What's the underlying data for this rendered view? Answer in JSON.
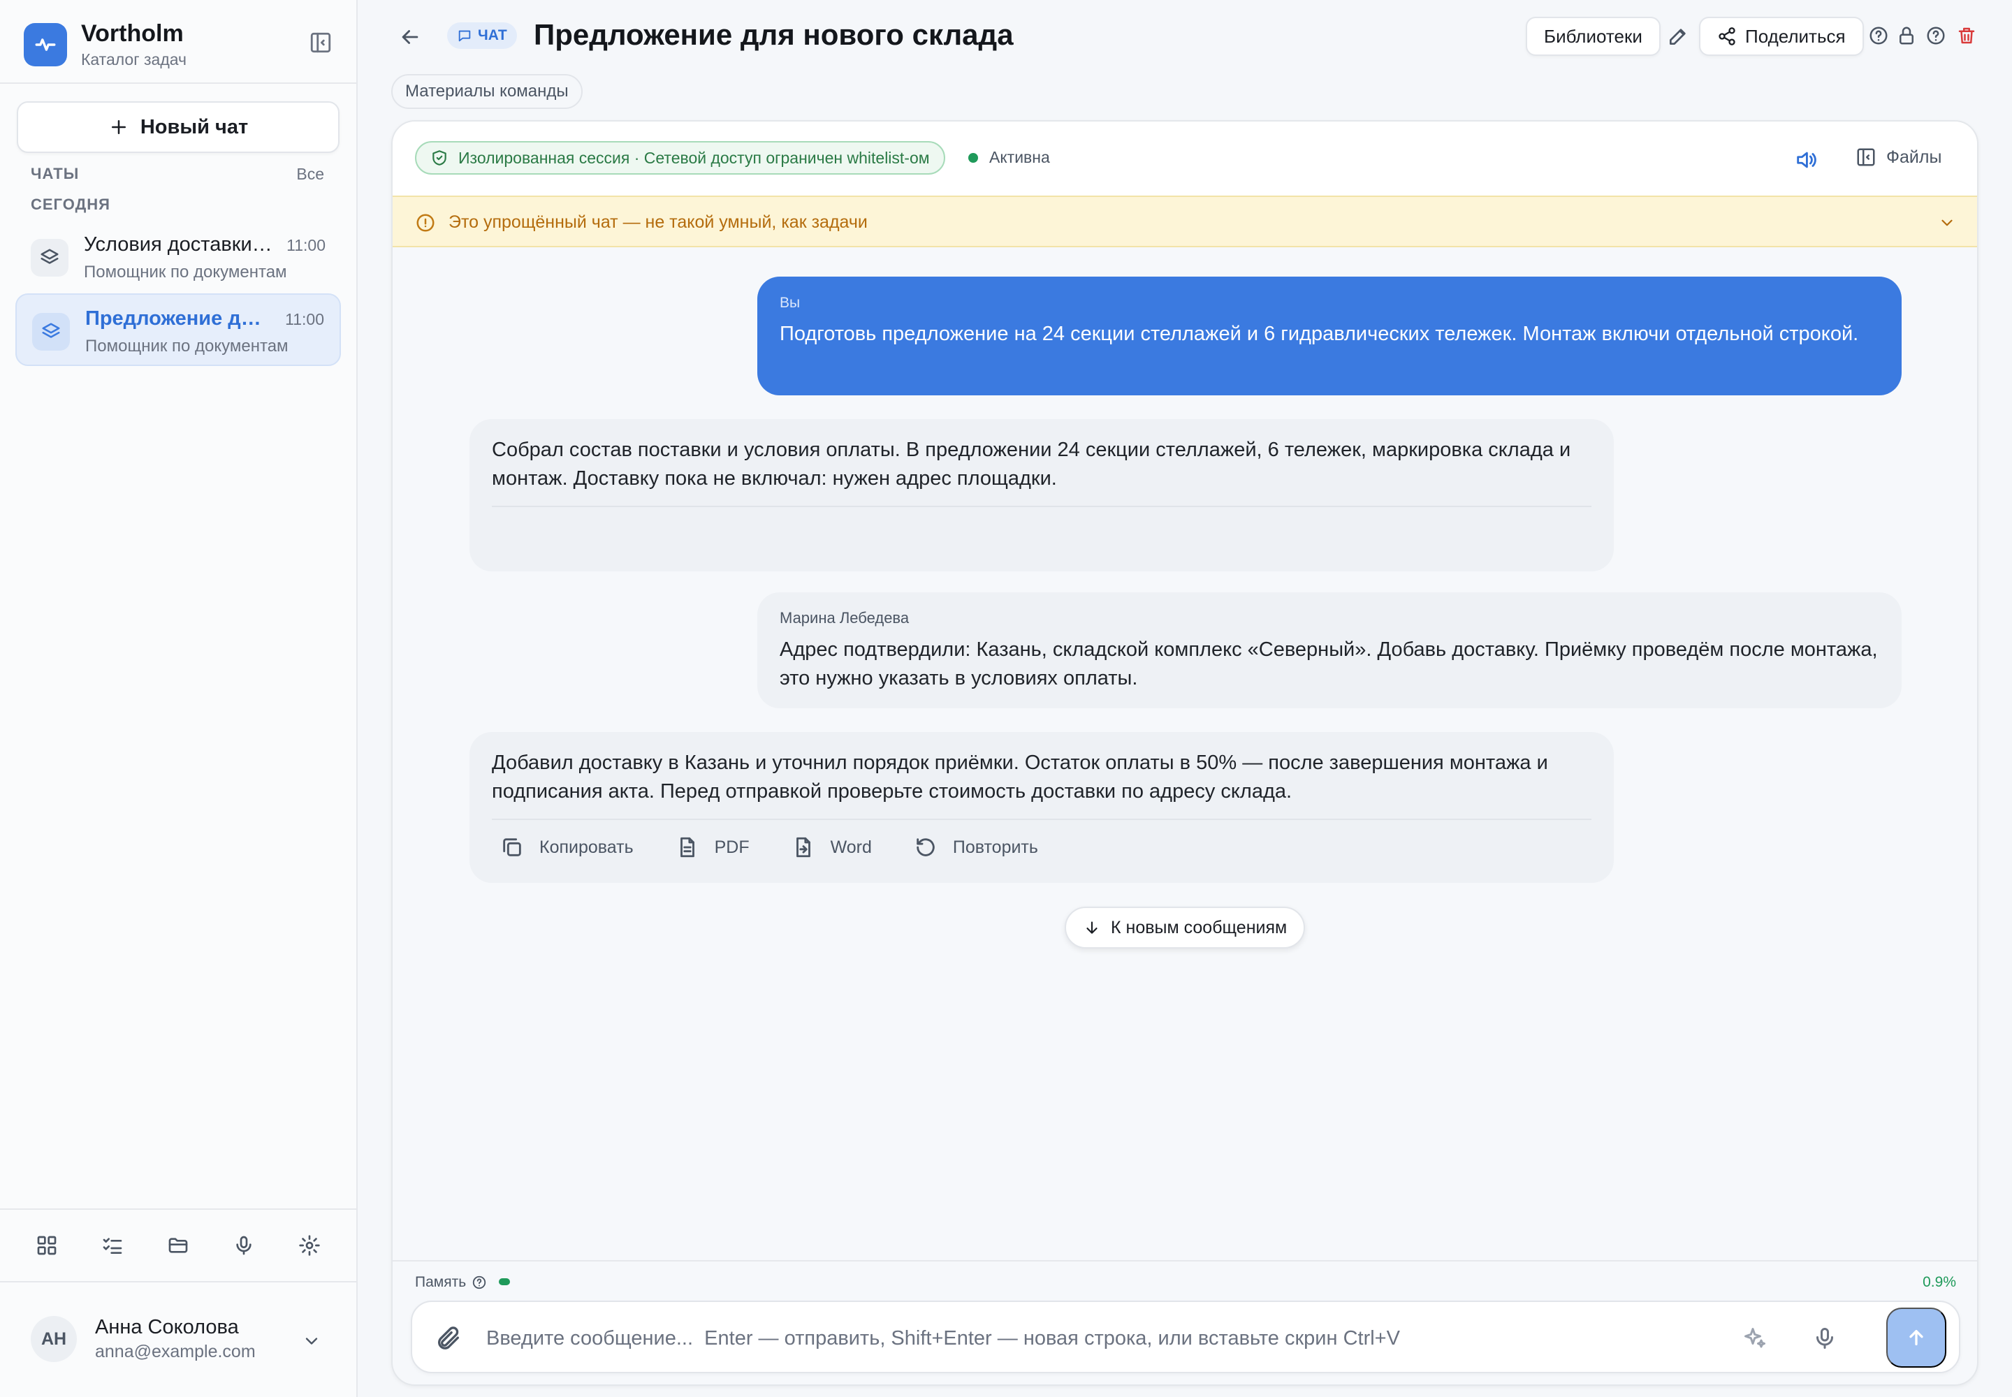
{
  "brand": {
    "title": "Vortholm",
    "subtitle": "Каталог задач"
  },
  "sidebar": {
    "new_chat_label": "Новый чат",
    "chats_label": "ЧАТЫ",
    "all_label": "Все",
    "today_label": "СЕГОДНЯ",
    "chats": [
      {
        "title": "Условия доставки по договору",
        "time": "11:00",
        "subtitle": "Помощник по документам",
        "active": false
      },
      {
        "title": "Предложение для нового склада",
        "time": "11:00",
        "subtitle": "Помощник по документам",
        "active": true
      }
    ],
    "tools": [
      "grid-icon",
      "checklist-icon",
      "folder-icon",
      "mic-icon",
      "gear-icon"
    ]
  },
  "user": {
    "initials": "АН",
    "name": "Анна Соколова",
    "email": "anna@example.com"
  },
  "header": {
    "badge": "ЧАТ",
    "title": "Предложение для нового склада",
    "libraries_label": "Библиотеки",
    "share_label": "Поделиться",
    "team_chip": "Материалы команды"
  },
  "panel": {
    "isolation_text": "Изолированная сессия · Сетевой доступ ограничен whitelist-ом",
    "status_text": "Активна",
    "files_label": "Файлы",
    "warning_text": "Это упрощённый чат — не такой умный, как задачи"
  },
  "messages": {
    "user1": {
      "author": "Вы",
      "text": "Подготовь предложение на 24 секции стеллажей и 6 гидравлических тележек. Монтаж включи отдельной строкой."
    },
    "bot1": {
      "text": "Собрал состав поставки и условия оплаты. В предложении 24 секции стеллажей, 6 тележек, маркировка склада и монтаж. Доставку пока не включал: нужен адрес площадки."
    },
    "user2": {
      "author": "Марина Лебедева",
      "text": "Адрес подтвердили: Казань, складской комплекс «Северный». Добавь доставку. Приёмку проведём после монтажа, это нужно указать в условиях оплаты."
    },
    "bot2": {
      "text": "Добавил доставку в Казань и уточнил порядок приёмки. Остаток оплаты в 50% — после завершения монтажа и подписания акта. Перед отправкой проверьте стоимость доставки по адресу склада.",
      "actions": {
        "copy": "Копировать",
        "pdf": "PDF",
        "word": "Word",
        "retry": "Повторить"
      }
    }
  },
  "to_new_label": "К новым сообщениям",
  "memory": {
    "label": "Память",
    "percent_text": "0.9%",
    "fraction": 0.009
  },
  "composer": {
    "placeholder": "Введите сообщение...  Enter — отправить, Shift+Enter — новая строка, или вставьте скрин Ctrl+V"
  },
  "colors": {
    "accent": "#3b7ae0",
    "success": "#1f9a5a",
    "danger": "#d93a3a",
    "warning_bg": "#fdf5d7"
  }
}
